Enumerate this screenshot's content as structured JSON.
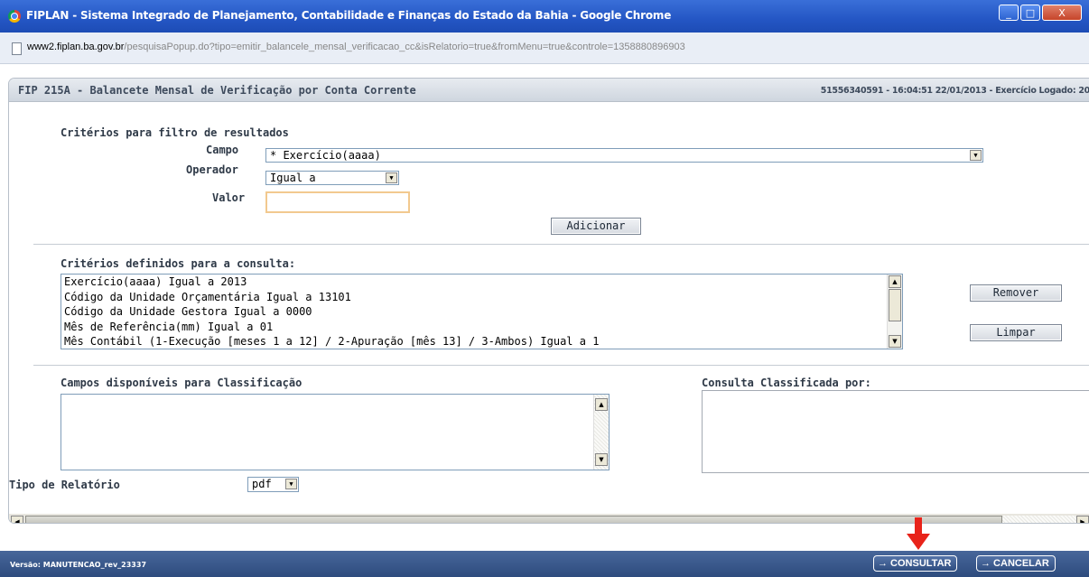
{
  "window": {
    "title": "FIPLAN - Sistema Integrado de Planejamento, Contabilidade e Finanças do Estado da Bahia - Google Chrome",
    "minimize_label": "_",
    "maximize_label": "□",
    "close_label": "X"
  },
  "address": {
    "host": "www2.fiplan.ba.gov.br",
    "path": "/pesquisaPopup.do?tipo=emitir_balancele_mensal_verificacao_cc&isRelatorio=true&fromMenu=true&controle=1358880896903"
  },
  "dialog": {
    "title": "FIP 215A - Balancete Mensal de Verificação por Conta Corrente",
    "info": "51556340591 - 16:04:51 22/01/2013 - Exercício Logado: 20"
  },
  "filter": {
    "section_title": "Critérios para filtro de resultados",
    "campo_label": "Campo",
    "campo_value": "* Exercício(aaaa)",
    "operador_label": "Operador",
    "operador_value": "Igual a",
    "valor_label": "Valor",
    "valor_value": "",
    "adicionar_label": "Adicionar"
  },
  "criteria": {
    "section_title": "Critérios definidos para a consulta:",
    "items": [
      "Exercício(aaaa) Igual a 2013",
      "Código da Unidade Orçamentária Igual a 13101",
      "Código da Unidade Gestora Igual a 0000",
      "Mês de Referência(mm) Igual a 01",
      "Mês Contábil (1-Execução [meses 1 a 12] / 2-Apuração [mês 13] / 3-Ambos) Igual a 1"
    ],
    "remover_label": "Remover",
    "limpar_label": "Limpar"
  },
  "classification": {
    "available_title": "Campos disponíveis para Classificação",
    "sorted_title": "Consulta Classificada por:"
  },
  "report": {
    "tipo_label": "Tipo de Relatório",
    "tipo_value": "pdf"
  },
  "footer": {
    "version": "Versão: MANUTENCAO_rev_23337",
    "consultar_label": "→ CONSULTAR",
    "cancelar_label": "→ CANCELAR"
  },
  "colors": {
    "titlebar": "#2456c4",
    "footer": "#2e4c7e",
    "annotation_arrow": "#e8231a",
    "input_focus_border": "#f2c98f"
  }
}
